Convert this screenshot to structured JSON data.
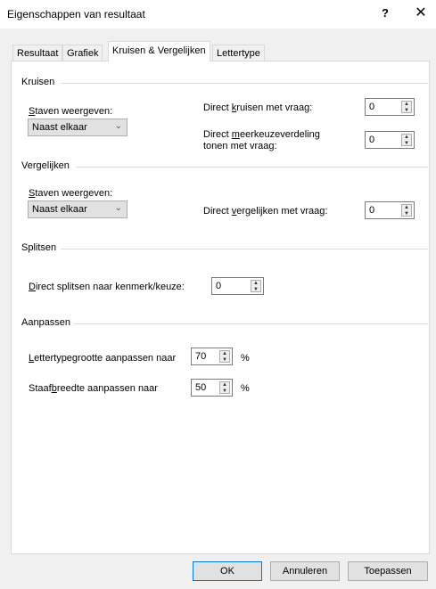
{
  "window": {
    "title": "Eigenschappen van resultaat",
    "help": "?",
    "close": "✕"
  },
  "tabs": [
    {
      "label": "Resultaat"
    },
    {
      "label": "Grafiek"
    },
    {
      "label": "Kruisen & Vergelijken"
    },
    {
      "label": "Lettertype"
    }
  ],
  "kruisen": {
    "heading": "Kruisen",
    "staven_label_pre": "",
    "staven_label_u": "S",
    "staven_label_post": "taven weergeven:",
    "staven_value": "Naast elkaar",
    "direct_kruisen_pre": "Direct ",
    "direct_kruisen_u": "k",
    "direct_kruisen_post": "ruisen met vraag:",
    "direct_kruisen_value": "0",
    "meerkeuze_pre": "Direct ",
    "meerkeuze_u": "m",
    "meerkeuze_post": "eerkeuzeverdeling",
    "meerkeuze_line2": "tonen met vraag:",
    "meerkeuze_value": "0"
  },
  "vergelijken": {
    "heading": "Vergelijken",
    "staven_label_u": "S",
    "staven_label_post": "taven weergeven:",
    "staven_value": "Naast elkaar",
    "direct_pre": "Direct ",
    "direct_u": "v",
    "direct_post": "ergelijken met vraag:",
    "direct_value": "0"
  },
  "splitsen": {
    "heading": "Splitsen",
    "direct_u": "D",
    "direct_post": "irect splitsen naar kenmerk/keuze:",
    "direct_value": "0"
  },
  "aanpassen": {
    "heading": "Aanpassen",
    "letter_u": "L",
    "letter_post": "ettertypegrootte aanpassen naar",
    "letter_value": "70",
    "letter_unit": "%",
    "staaf_pre": "Staaf",
    "staaf_u": "b",
    "staaf_post": "reedte aanpassen naar",
    "staaf_value": "50",
    "staaf_unit": "%"
  },
  "buttons": {
    "ok": "OK",
    "cancel": "Annuleren",
    "apply": "Toepassen"
  }
}
